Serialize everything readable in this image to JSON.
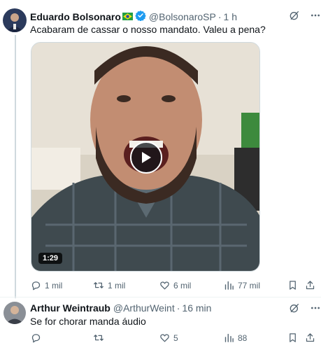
{
  "tweet": {
    "author_name": "Eduardo Bolsonaro",
    "handle": "@BolsonaroSP",
    "separator": "·",
    "time": "1 h",
    "text": "Acabaram de cassar o nosso mandato. Valeu a pena?",
    "video_duration": "1:29",
    "actions": {
      "replies": "1 mil",
      "retweets": "1 mil",
      "likes": "6 mil",
      "views": "77 mil"
    }
  },
  "reply": {
    "author_name": "Arthur Weintraub",
    "handle": "@ArthurWeint",
    "separator": "·",
    "time": "16 min",
    "text": "Se for chorar manda áudio",
    "actions": {
      "replies": "",
      "retweets": "",
      "likes": "5",
      "views": "88"
    }
  },
  "colors": {
    "text": "#0f1419",
    "secondary": "#536471",
    "verified": "#1d9bf0",
    "divider": "#eff3f4"
  },
  "icons": [
    "grok-icon",
    "more-icon",
    "verified-badge-icon",
    "brazil-flag-icon",
    "play-icon",
    "reply-icon",
    "retweet-icon",
    "like-icon",
    "views-icon",
    "bookmark-icon",
    "share-icon"
  ]
}
